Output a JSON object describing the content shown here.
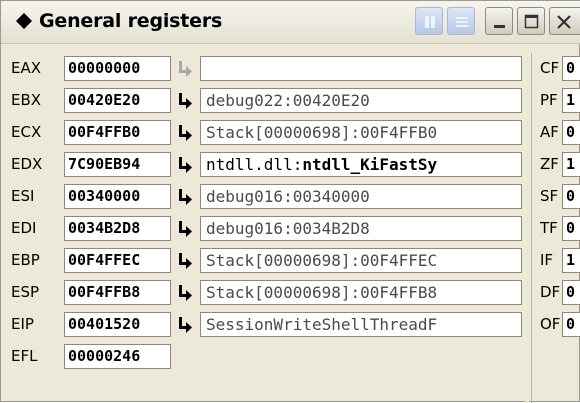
{
  "window": {
    "title": "General registers",
    "buttons": [
      "faded-button-1",
      "faded-button-2",
      "minimize",
      "maximize",
      "close"
    ]
  },
  "registers": [
    {
      "name": "EAX",
      "value": "00000000",
      "ref_prefix": "",
      "ref_symbol": "",
      "icon": "jump-arrow-disabled"
    },
    {
      "name": "EBX",
      "value": "00420E20",
      "ref_prefix": "debug022:00420E20",
      "ref_symbol": "",
      "icon": "jump-arrow"
    },
    {
      "name": "ECX",
      "value": "00F4FFB0",
      "ref_prefix": "Stack[00000698]:00F4FFB0",
      "ref_symbol": "",
      "icon": "jump-arrow"
    },
    {
      "name": "EDX",
      "value": "7C90EB94",
      "ref_prefix": "ntdll.dll:",
      "ref_symbol": "ntdll_KiFastSy",
      "icon": "jump-arrow"
    },
    {
      "name": "ESI",
      "value": "00340000",
      "ref_prefix": "debug016:00340000",
      "ref_symbol": "",
      "icon": "jump-arrow"
    },
    {
      "name": "EDI",
      "value": "0034B2D8",
      "ref_prefix": "debug016:0034B2D8",
      "ref_symbol": "",
      "icon": "jump-arrow"
    },
    {
      "name": "EBP",
      "value": "00F4FFEC",
      "ref_prefix": "Stack[00000698]:00F4FFEC",
      "ref_symbol": "",
      "icon": "jump-arrow"
    },
    {
      "name": "ESP",
      "value": "00F4FFB8",
      "ref_prefix": "Stack[00000698]:00F4FFB8",
      "ref_symbol": "",
      "icon": "jump-arrow"
    },
    {
      "name": "EIP",
      "value": "00401520",
      "ref_prefix": "SessionWriteShellThreadF",
      "ref_symbol": "",
      "icon": "jump-arrow"
    },
    {
      "name": "EFL",
      "value": "00000246"
    }
  ],
  "flags": [
    {
      "name": "CF",
      "value": "0"
    },
    {
      "name": "PF",
      "value": "1"
    },
    {
      "name": "AF",
      "value": "0"
    },
    {
      "name": "ZF",
      "value": "1"
    },
    {
      "name": "SF",
      "value": "0"
    },
    {
      "name": "TF",
      "value": "0"
    },
    {
      "name": "IF",
      "value": "1"
    },
    {
      "name": "DF",
      "value": "0"
    },
    {
      "name": "OF",
      "value": "0"
    }
  ],
  "colors": {
    "window_bg": "#ece9d8",
    "field_border": "#8d8a7d",
    "arrow_active": "#000000",
    "arrow_disabled": "#a8a8a8"
  }
}
